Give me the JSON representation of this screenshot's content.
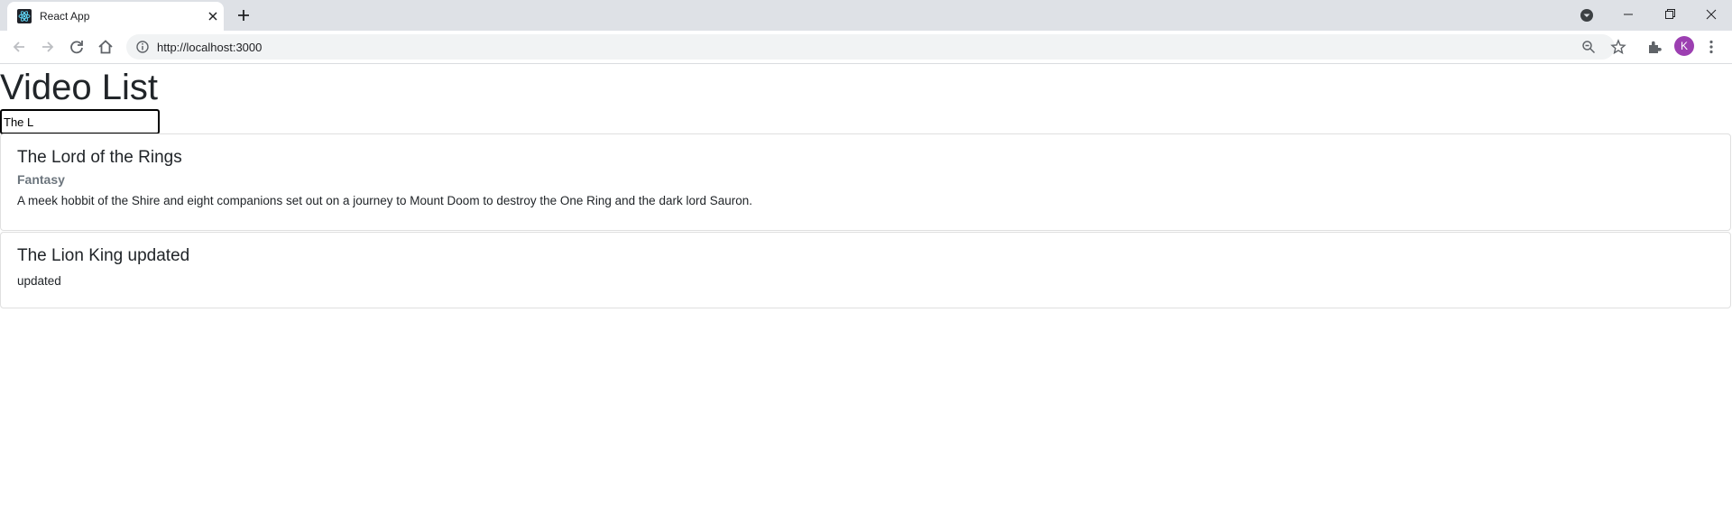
{
  "browser": {
    "tab_title": "React App",
    "url": "http://localhost:3000",
    "profile_initial": "K"
  },
  "page": {
    "title": "Video List",
    "search_value": "The L"
  },
  "videos": [
    {
      "title": "The Lord of the Rings",
      "genre": "Fantasy",
      "description": "A meek hobbit of the Shire and eight companions set out on a journey to Mount Doom to destroy the One Ring and the dark lord Sauron."
    },
    {
      "title": "The Lion King updated",
      "genre": "",
      "description": "updated"
    }
  ],
  "colors": {
    "tabstrip": "#dee1e6",
    "avatar": "#9c3fb1",
    "subtitle": "#6c757d"
  }
}
